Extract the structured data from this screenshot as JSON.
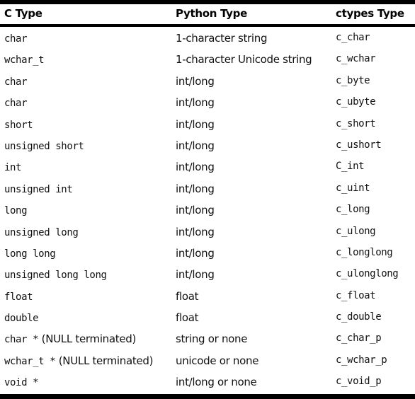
{
  "table": {
    "headers": [
      "C Type",
      "Python Type",
      "ctypes Type"
    ],
    "rows": [
      {
        "c_type": "char",
        "c_type_note": "",
        "python_type": "1-character string",
        "ctypes_type": "c_char"
      },
      {
        "c_type": "wchar_t",
        "c_type_note": "",
        "python_type": "1-character Unicode string",
        "ctypes_type": "c_wchar"
      },
      {
        "c_type": "char",
        "c_type_note": "",
        "python_type": "int/long",
        "ctypes_type": "c_byte"
      },
      {
        "c_type": "char",
        "c_type_note": "",
        "python_type": "int/long",
        "ctypes_type": "c_ubyte"
      },
      {
        "c_type": "short",
        "c_type_note": "",
        "python_type": "int/long",
        "ctypes_type": "c_short"
      },
      {
        "c_type": "unsigned short",
        "c_type_note": "",
        "python_type": "int/long",
        "ctypes_type": "c_ushort"
      },
      {
        "c_type": "int",
        "c_type_note": "",
        "python_type": "int/long",
        "ctypes_type": "C_int"
      },
      {
        "c_type": "unsigned int",
        "c_type_note": "",
        "python_type": "int/long",
        "ctypes_type": "c_uint"
      },
      {
        "c_type": "long",
        "c_type_note": "",
        "python_type": "int/long",
        "ctypes_type": "c_long"
      },
      {
        "c_type": "unsigned long",
        "c_type_note": "",
        "python_type": "int/long",
        "ctypes_type": "c_ulong"
      },
      {
        "c_type": "long long",
        "c_type_note": "",
        "python_type": "int/long",
        "ctypes_type": "c_longlong"
      },
      {
        "c_type": "unsigned long long",
        "c_type_note": "",
        "python_type": "int/long",
        "ctypes_type": "c_ulonglong"
      },
      {
        "c_type": "float",
        "c_type_note": "",
        "python_type": "float",
        "ctypes_type": "c_float"
      },
      {
        "c_type": "double",
        "c_type_note": "",
        "python_type": "float",
        "ctypes_type": "c_double"
      },
      {
        "c_type": "char *",
        "c_type_note": " (NULL terminated)",
        "python_type": "string or none",
        "ctypes_type": "c_char_p"
      },
      {
        "c_type": "wchar_t *",
        "c_type_note": " (NULL terminated)",
        "python_type": "unicode or none",
        "ctypes_type": "c_wchar_p"
      },
      {
        "c_type": "void *",
        "c_type_note": "",
        "python_type": "int/long or none",
        "ctypes_type": "c_void_p"
      }
    ]
  }
}
